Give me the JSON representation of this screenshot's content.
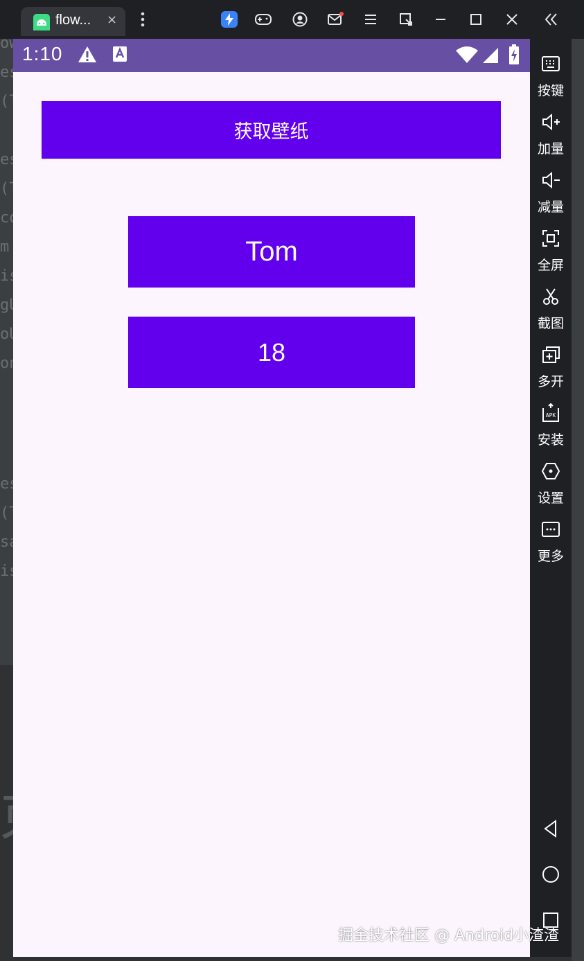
{
  "window": {
    "tab_title": "flow...",
    "tab_close": "×"
  },
  "statusbar": {
    "time": "1:10"
  },
  "app": {
    "wallpaper_button": "获取壁纸",
    "name_button": "Tom",
    "age_button": "18"
  },
  "sidebar": {
    "items": [
      {
        "label": "按键",
        "icon": "keyboard-icon"
      },
      {
        "label": "加量",
        "icon": "volume-up-icon"
      },
      {
        "label": "减量",
        "icon": "volume-down-icon"
      },
      {
        "label": "全屏",
        "icon": "fullscreen-icon"
      },
      {
        "label": "截图",
        "icon": "scissors-icon"
      },
      {
        "label": "多开",
        "icon": "multi-instance-icon"
      },
      {
        "label": "安装",
        "icon": "apk-install-icon"
      },
      {
        "label": "设置",
        "icon": "settings-icon"
      },
      {
        "label": "更多",
        "icon": "more-icon"
      }
    ]
  },
  "watermark": "掘金技术社区 @ Android小渣渣",
  "colors": {
    "button": "#6200ee",
    "statusbar": "#6750a4",
    "screen_bg": "#fcf5fe",
    "chrome": "#1f2024"
  }
}
